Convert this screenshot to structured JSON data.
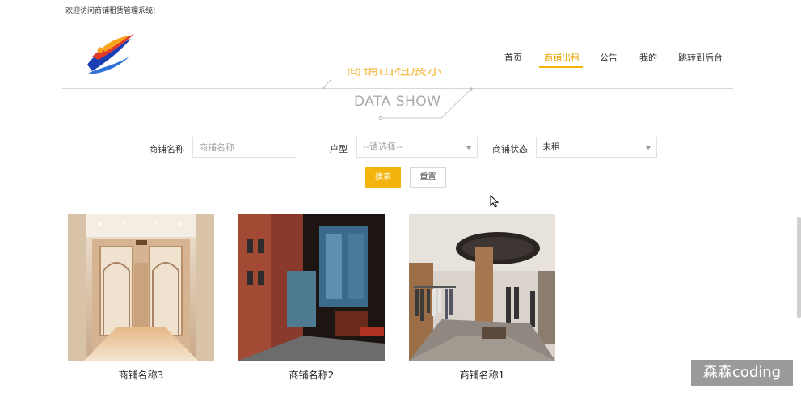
{
  "header": {
    "welcome": "欢迎访问商铺租赁管理系统!"
  },
  "nav": {
    "items": [
      {
        "label": "首页",
        "active": false
      },
      {
        "label": "商铺出租",
        "active": true
      },
      {
        "label": "公告",
        "active": false
      },
      {
        "label": "我的",
        "active": false
      },
      {
        "label": "跳转到后台",
        "active": false
      }
    ]
  },
  "section": {
    "title": "商铺出租展示",
    "subtitle": "DATA SHOW"
  },
  "filters": {
    "name_label": "商铺名称",
    "name_placeholder": "商铺名称",
    "type_label": "户型",
    "type_value": "--请选择--",
    "status_label": "商铺状态",
    "status_value": "未租"
  },
  "buttons": {
    "search": "搜索",
    "reset": "重置"
  },
  "shops": [
    {
      "name": "商铺名称3"
    },
    {
      "name": "商铺名称2"
    },
    {
      "name": "商铺名称1"
    }
  ],
  "watermark": "森森coding",
  "colors": {
    "accent": "#f3b50d",
    "active_nav": "#e8a400"
  }
}
